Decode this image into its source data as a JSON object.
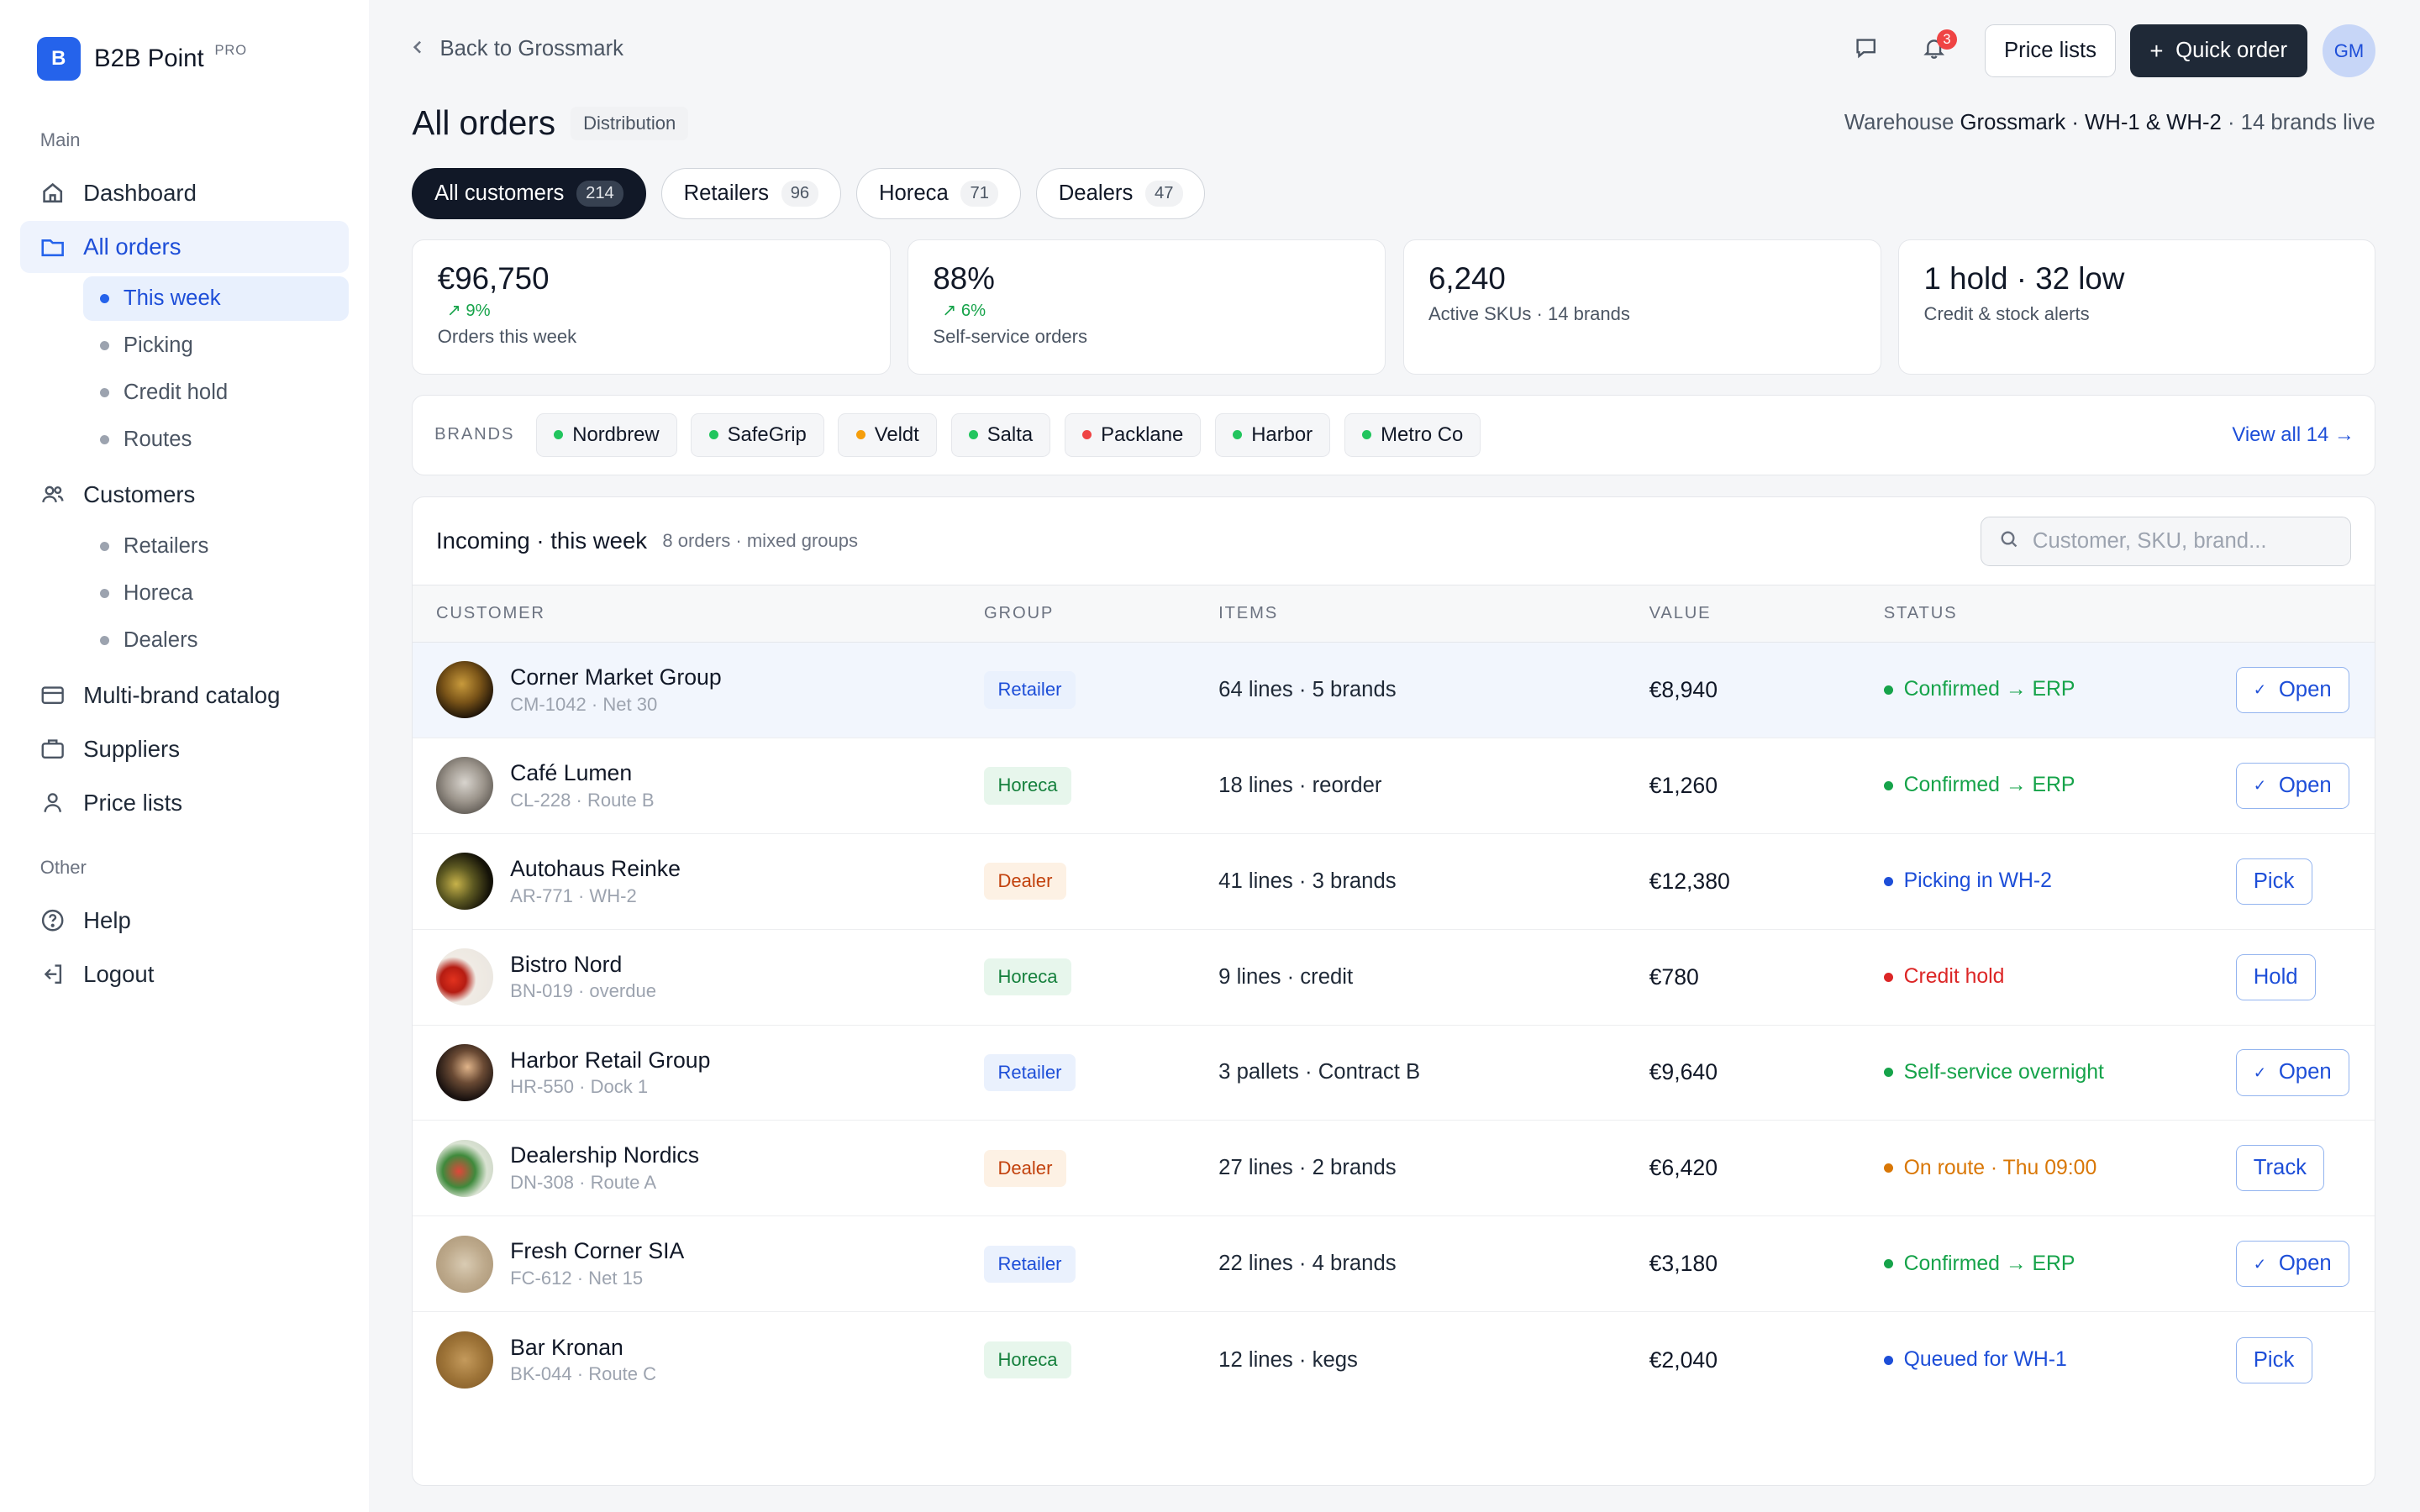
{
  "brand": {
    "logo_letter": "B",
    "name": "B2B Point",
    "tier": "PRO"
  },
  "sidebar": {
    "main_label": "Main",
    "other_label": "Other",
    "dashboard": "Dashboard",
    "all_orders": "All orders",
    "orders_sub": [
      "This week",
      "Picking",
      "Credit hold",
      "Routes"
    ],
    "customers": "Customers",
    "customers_sub": [
      "Retailers",
      "Horeca",
      "Dealers"
    ],
    "catalog": "Multi-brand catalog",
    "suppliers": "Suppliers",
    "price_lists": "Price lists",
    "help": "Help",
    "logout": "Logout"
  },
  "topbar": {
    "back": "Back to Grossmark",
    "notif_count": "3",
    "price_lists": "Price lists",
    "quick_order": "Quick order",
    "avatar": "GM"
  },
  "header": {
    "title": "All orders",
    "tag": "Distribution",
    "warehouse_prefix": "Warehouse ",
    "warehouse_name": "Grossmark · WH-1 & WH-2",
    "warehouse_suffix": " · 14 brands live"
  },
  "segments": [
    {
      "label": "All customers",
      "count": "214"
    },
    {
      "label": "Retailers",
      "count": "96"
    },
    {
      "label": "Horeca",
      "count": "71"
    },
    {
      "label": "Dealers",
      "count": "47"
    }
  ],
  "kpis": [
    {
      "value": "€96,750",
      "delta": "9%",
      "label": "Orders this week"
    },
    {
      "value": "88%",
      "delta": "6%",
      "label": "Self-service orders"
    },
    {
      "value": "6,240",
      "delta": "",
      "label": "Active SKUs · 14 brands"
    },
    {
      "value": "1 hold · 32 low",
      "delta": "",
      "label": "Credit & stock alerts"
    }
  ],
  "brands": {
    "label": "BRANDS",
    "items": [
      {
        "name": "Nordbrew",
        "color": "#22c55e"
      },
      {
        "name": "SafeGrip",
        "color": "#22c55e"
      },
      {
        "name": "Veldt",
        "color": "#f59e0b"
      },
      {
        "name": "Salta",
        "color": "#22c55e"
      },
      {
        "name": "Packlane",
        "color": "#ef4444"
      },
      {
        "name": "Harbor",
        "color": "#22c55e"
      },
      {
        "name": "Metro Co",
        "color": "#22c55e"
      }
    ],
    "view_all": "View all 14 →"
  },
  "table": {
    "title": "Incoming · this week",
    "subtitle": "8 orders · mixed groups",
    "search_placeholder": "Customer, SKU, brand...",
    "columns": [
      "CUSTOMER",
      "GROUP",
      "ITEMS",
      "VALUE",
      "STATUS"
    ],
    "rows": [
      {
        "name": "Corner Market Group",
        "meta": "CM-1042 · Net 30",
        "group": "Retailer",
        "items": "64 lines · 5 brands",
        "value": "€8,940",
        "status": "Confirmed → ERP",
        "status_color": "#16a34a",
        "action": "Open",
        "check": true
      },
      {
        "name": "Café Lumen",
        "meta": "CL-228 · Route B",
        "group": "Horeca",
        "items": "18 lines · reorder",
        "value": "€1,260",
        "status": "Confirmed → ERP",
        "status_color": "#16a34a",
        "action": "Open",
        "check": true
      },
      {
        "name": "Autohaus Reinke",
        "meta": "AR-771 · WH-2",
        "group": "Dealer",
        "items": "41 lines · 3 brands",
        "value": "€12,380",
        "status": "Picking in WH-2",
        "status_color": "#1d4ed8",
        "action": "Pick",
        "check": false
      },
      {
        "name": "Bistro Nord",
        "meta": "BN-019 · overdue",
        "group": "Horeca",
        "items": "9 lines · credit",
        "value": "€780",
        "status": "Credit hold",
        "status_color": "#dc2626",
        "action": "Hold",
        "check": false
      },
      {
        "name": "Harbor Retail Group",
        "meta": "HR-550 · Dock 1",
        "group": "Retailer",
        "items": "3 pallets · Contract B",
        "value": "€9,640",
        "status": "Self-service overnight",
        "status_color": "#16a34a",
        "action": "Open",
        "check": true
      },
      {
        "name": "Dealership Nordics",
        "meta": "DN-308 · Route A",
        "group": "Dealer",
        "items": "27 lines · 2 brands",
        "value": "€6,420",
        "status": "On route · Thu 09:00",
        "status_color": "#d97706",
        "action": "Track",
        "check": false
      },
      {
        "name": "Fresh Corner SIA",
        "meta": "FC-612 · Net 15",
        "group": "Retailer",
        "items": "22 lines · 4 brands",
        "value": "€3,180",
        "status": "Confirmed → ERP",
        "status_color": "#16a34a",
        "action": "Open",
        "check": true
      },
      {
        "name": "Bar Kronan",
        "meta": "BK-044 · Route C",
        "group": "Horeca",
        "items": "12 lines · kegs",
        "value": "€2,040",
        "status": "Queued for WH-1",
        "status_color": "#1d4ed8",
        "action": "Pick",
        "check": false
      }
    ]
  }
}
